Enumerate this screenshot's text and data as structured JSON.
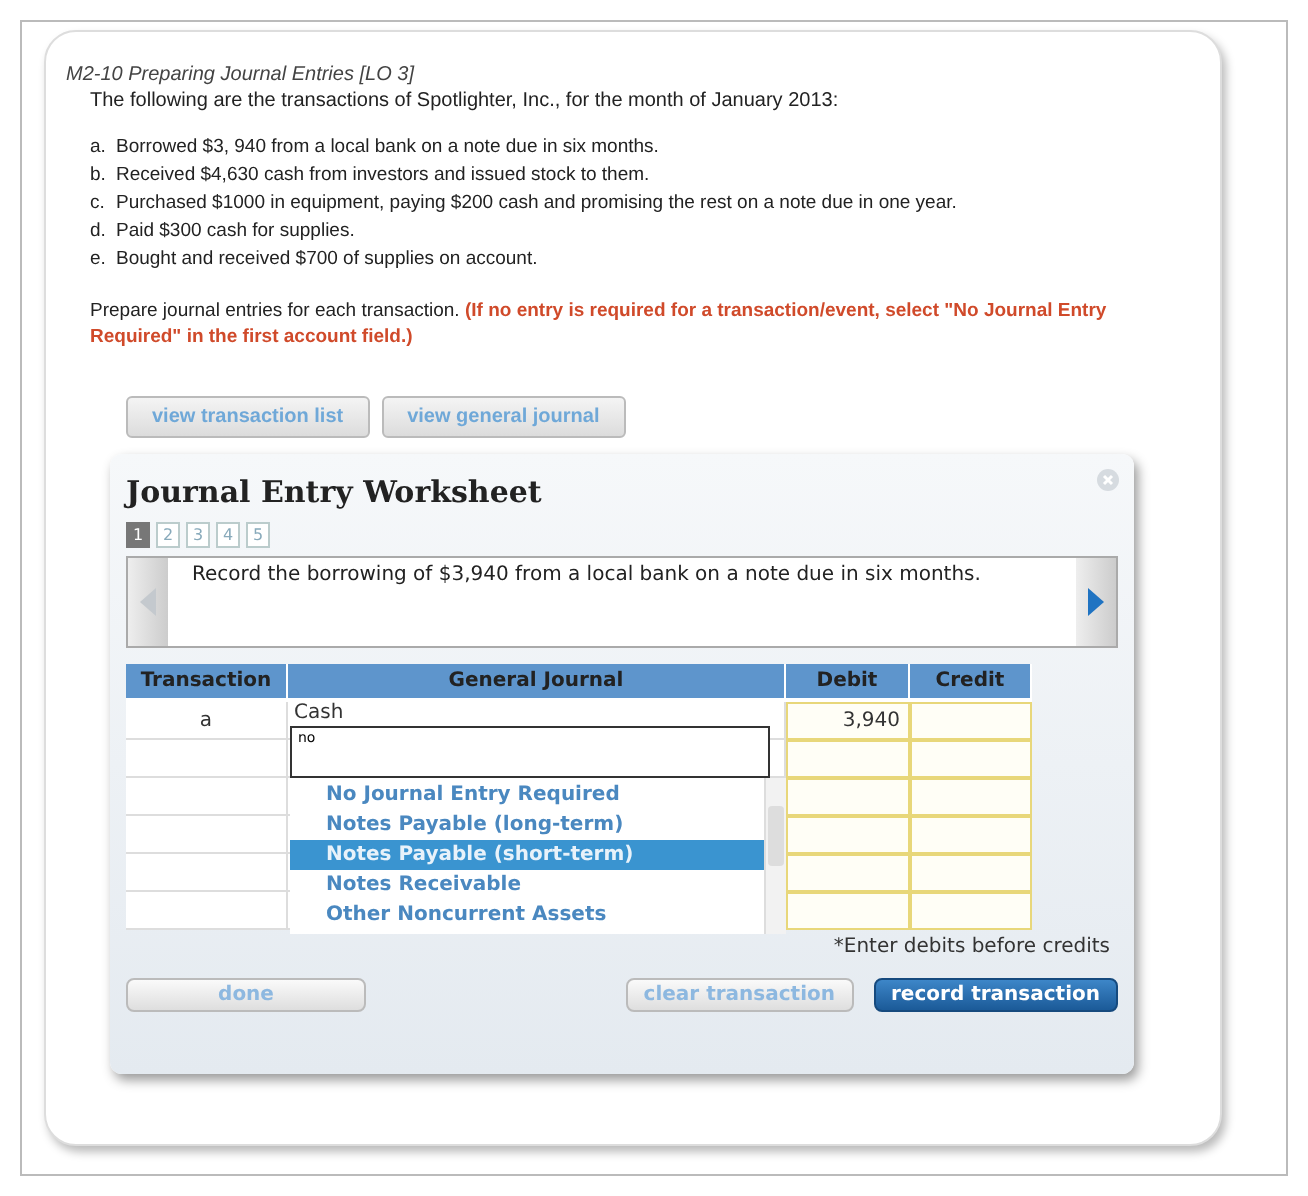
{
  "problem": {
    "title": "M2-10 Preparing Journal Entries [LO 3]",
    "intro": "The following are the transactions of Spotlighter, Inc., for the month of January 2013:",
    "transactions": [
      {
        "letter": "a.",
        "text": "Borrowed $3, 940 from a local bank on a note due in six months."
      },
      {
        "letter": "b.",
        "text": "Received $4,630 cash from investors and issued stock to them."
      },
      {
        "letter": "c.",
        "text": "Purchased $1000 in equipment, paying $200 cash and promising the rest on a note due in one year."
      },
      {
        "letter": "d.",
        "text": "Paid $300 cash for supplies."
      },
      {
        "letter": "e.",
        "text": "Bought and received $700 of supplies on account."
      }
    ],
    "instruction": "Prepare journal entries for each transaction. **(If no entry is required for a transaction/event, select \"No Journal Entry Required\" in the first account field.)**"
  },
  "view_buttons": [
    "view transaction list",
    "view general journal"
  ],
  "worksheet": {
    "title": "Journal Entry Worksheet",
    "pages": [
      {
        "label": "1",
        "selected": true
      },
      {
        "label": "2",
        "selected": false
      },
      {
        "label": "3",
        "selected": false
      },
      {
        "label": "4",
        "selected": false
      },
      {
        "label": "5",
        "selected": false
      }
    ],
    "prompt": "Record the borrowing of $3,940 from a local bank on a note due in six months.",
    "columns": [
      "Transaction",
      "General Journal",
      "Debit",
      "Credit"
    ],
    "rows": [
      {
        "transaction": "a",
        "account": "Cash",
        "debit": "3,940",
        "credit": ""
      },
      {
        "transaction": "",
        "account": "",
        "debit": "",
        "credit": ""
      },
      {
        "transaction": "",
        "account": "",
        "debit": "",
        "credit": ""
      },
      {
        "transaction": "",
        "account": "",
        "debit": "",
        "credit": ""
      },
      {
        "transaction": "",
        "account": "",
        "debit": "",
        "credit": ""
      },
      {
        "transaction": "",
        "account": "",
        "debit": "",
        "credit": ""
      }
    ],
    "account_input": {
      "value": "no"
    },
    "dropdown": [
      {
        "label": "No Journal Entry Required",
        "selected": false
      },
      {
        "label": "Notes Payable (long-term)",
        "selected": false
      },
      {
        "label": "Notes Payable (short-term)",
        "selected": true
      },
      {
        "label": "Notes Receivable",
        "selected": false
      },
      {
        "label": "Other Noncurrent Assets",
        "selected": false
      }
    ],
    "footnote": "*Enter debits before credits",
    "buttons": [
      {
        "label": "done",
        "kind": "plain"
      },
      {
        "label": "clear transaction",
        "kind": "plain"
      },
      {
        "label": "record transaction",
        "kind": "primary"
      }
    ]
  }
}
